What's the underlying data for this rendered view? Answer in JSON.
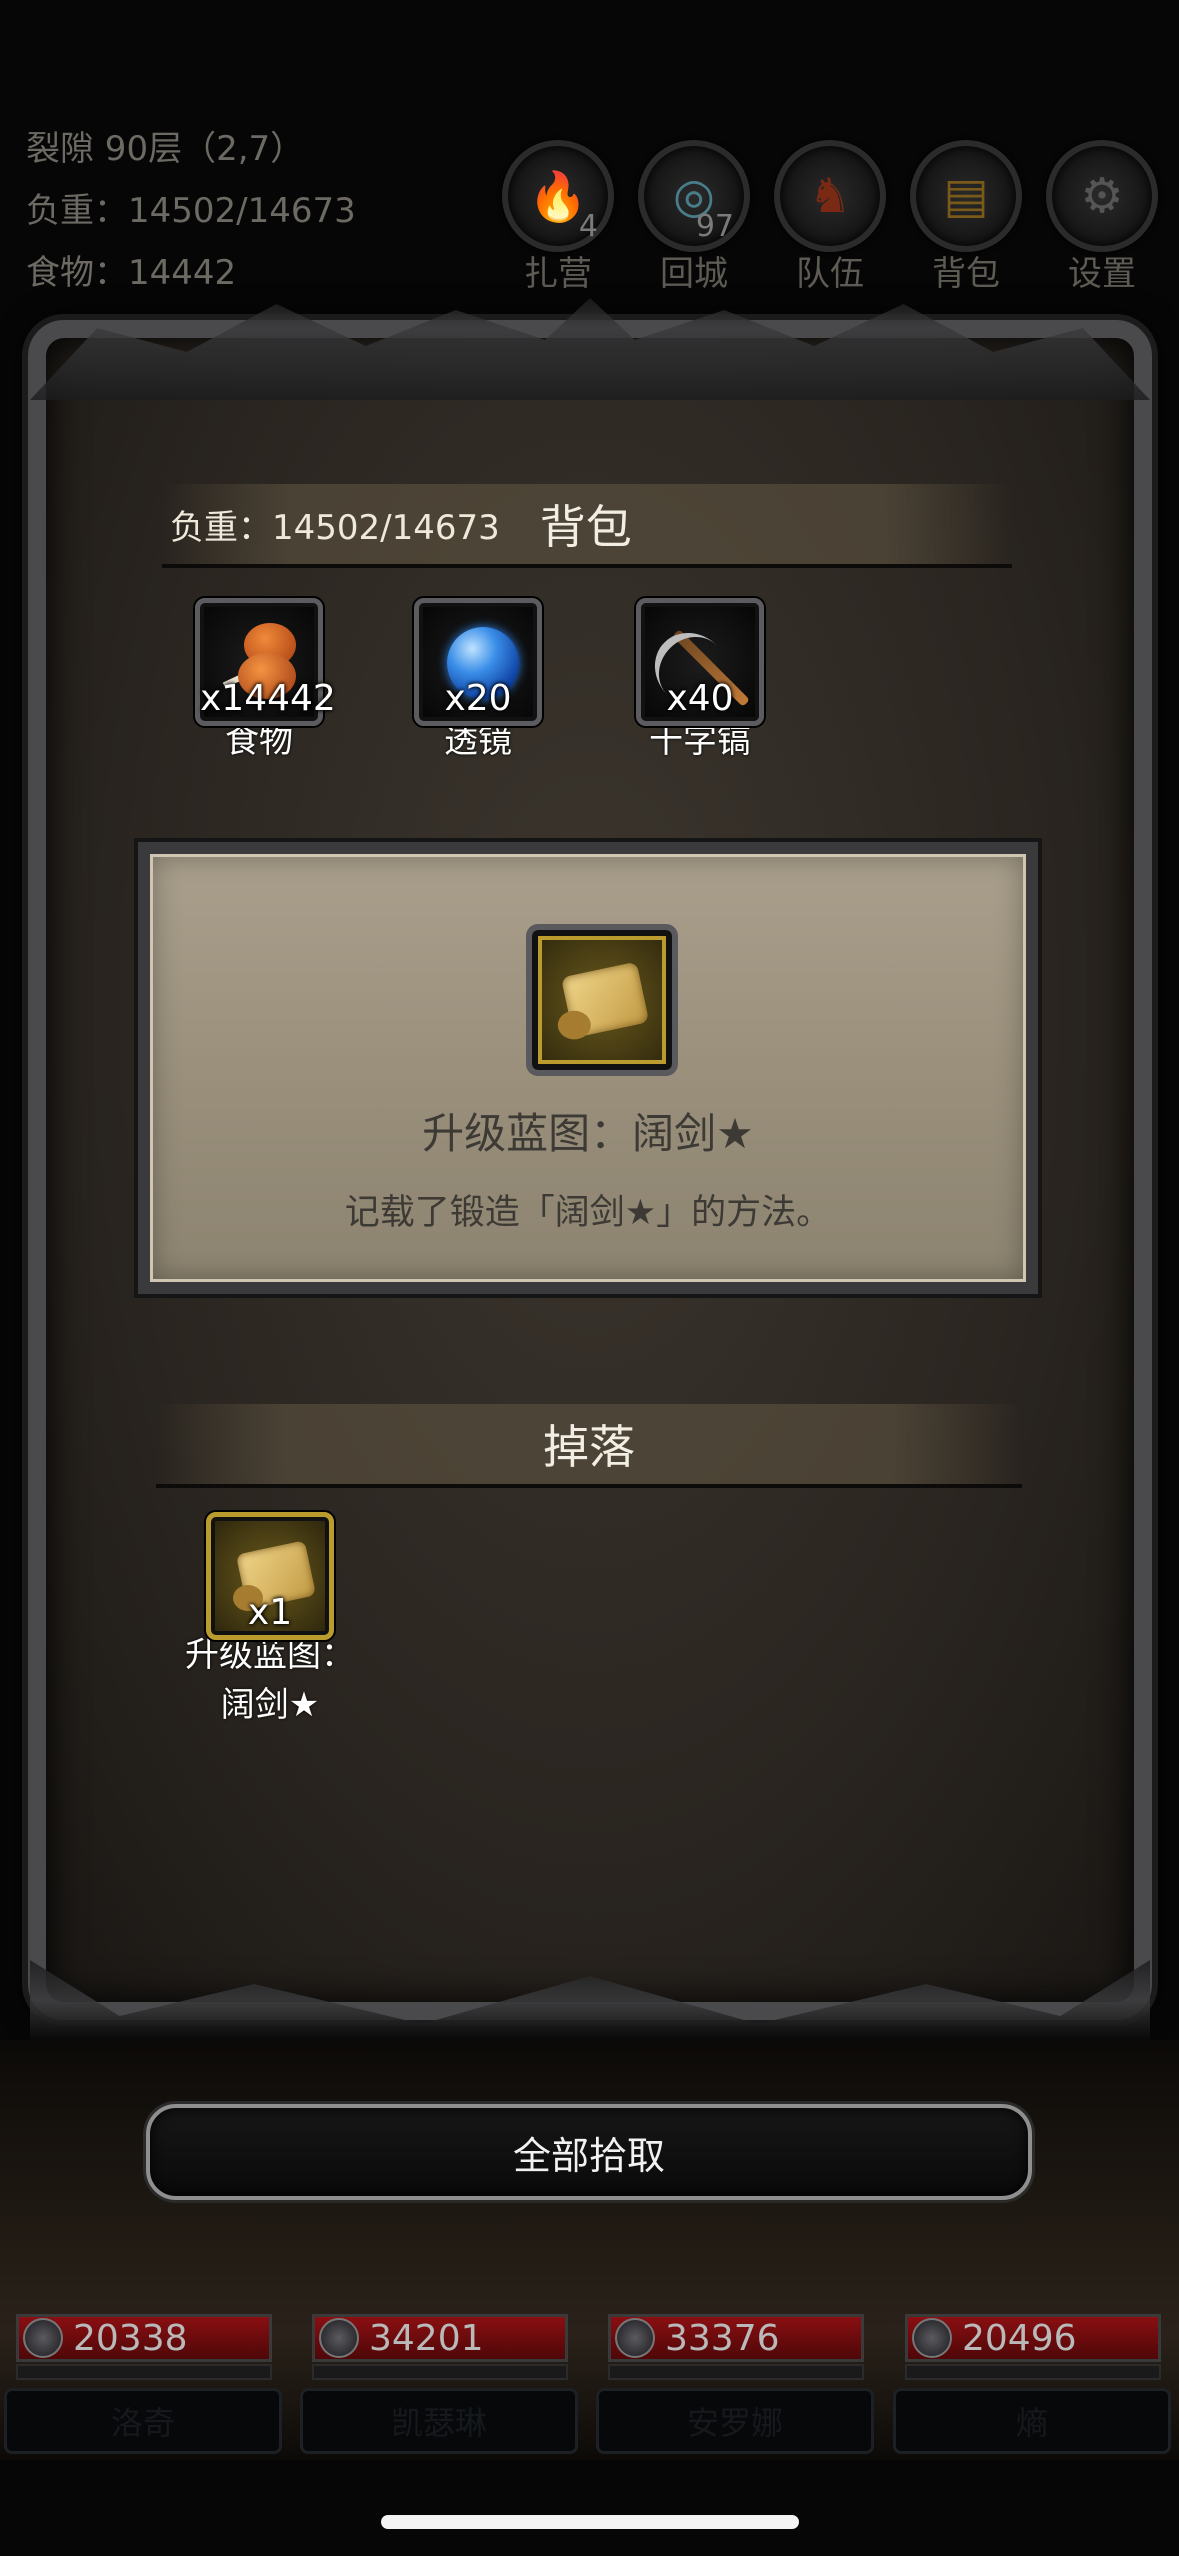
{
  "hud": {
    "location": "裂隙 90层（2,7）",
    "weight": "负重：14502/14673",
    "food": "食物：14442"
  },
  "top_buttons": [
    {
      "label": "扎营",
      "badge": "4",
      "icon": "campfire-icon"
    },
    {
      "label": "回城",
      "badge": "97",
      "icon": "portal-icon"
    },
    {
      "label": "队伍",
      "badge": "",
      "icon": "team-icon"
    },
    {
      "label": "背包",
      "badge": "",
      "icon": "backpack-icon"
    },
    {
      "label": "设置",
      "badge": "",
      "icon": "gear-icon"
    }
  ],
  "bag": {
    "weight": "负重：14502/14673",
    "title": "背包",
    "items": [
      {
        "name": "食物",
        "qty": "x14442",
        "icon": "meat-icon"
      },
      {
        "name": "透镜",
        "qty": "x20",
        "icon": "lens-icon"
      },
      {
        "name": "十字镐",
        "qty": "x40",
        "icon": "pickaxe-icon"
      }
    ]
  },
  "detail": {
    "icon": "scroll-icon",
    "title": "升级蓝图：阔剑★",
    "desc": "记载了锻造「阔剑★」的方法。"
  },
  "drops": {
    "title": "掉落",
    "items": [
      {
        "name_line1": "升级蓝图：",
        "name_line2": "阔剑★",
        "qty": "x1",
        "icon": "scroll-icon"
      }
    ]
  },
  "pickup_all": "全部拾取",
  "party": [
    {
      "hp": "20338",
      "name": "洛奇"
    },
    {
      "hp": "34201",
      "name": "凯瑟琳"
    },
    {
      "hp": "33376",
      "name": "安罗娜"
    },
    {
      "hp": "20496",
      "name": "熵"
    }
  ],
  "colors": {
    "hp_bar": "#8a0f12",
    "gold_border": "#b99b2e",
    "panel": "#a99f8c"
  }
}
